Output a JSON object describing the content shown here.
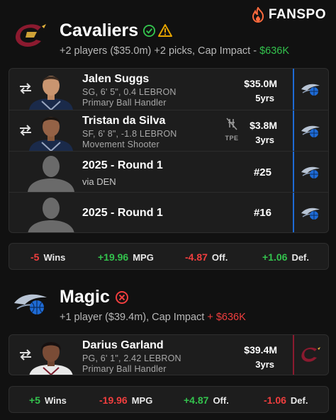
{
  "brand": {
    "name": "FANSPO",
    "logo_icon": "fanspo-flame-icon"
  },
  "colors": {
    "positive": "#33c24d",
    "negative": "#f03e3e",
    "magic_blue": "#1e6bd6",
    "cavs_wine": "#8b1a2f",
    "check": "#33c24d",
    "warn": "#e6a400"
  },
  "cavaliers": {
    "team_name": "Cavaliers",
    "status_icons": [
      "check-circle-icon",
      "warning-triangle-icon"
    ],
    "summary_main": "+2 players ($35.0m) +2 picks, Cap Impact - ",
    "summary_value": "$636K",
    "players": [
      {
        "name": "Jalen Suggs",
        "details": "SG, 6' 5\", 0.4 LEBRON",
        "role": "Primary Ball Handler",
        "salary": "$35.0M",
        "years": "5yrs",
        "from_logo": "magic-logo"
      },
      {
        "name": "Tristan da Silva",
        "details": "SF, 6' 8\", -1.8 LEBRON",
        "role": "Movement Shooter",
        "salary": "$3.8M",
        "years": "3yrs",
        "tpe_label": "TPE",
        "from_logo": "magic-logo"
      }
    ],
    "picks": [
      {
        "label": "2025 - Round 1",
        "via": "via DEN",
        "number": "#25",
        "from_logo": "magic-logo"
      },
      {
        "label": "2025 - Round 1",
        "number": "#16",
        "from_logo": "magic-logo"
      }
    ],
    "stats": {
      "wins": "-5",
      "wins_label": "Wins",
      "mpg": "+19.96",
      "mpg_label": "MPG",
      "off": "-4.87",
      "off_label": "Off.",
      "def": "+1.06",
      "def_label": "Def."
    }
  },
  "magic": {
    "team_name": "Magic",
    "status_icons": [
      "error-circle-icon"
    ],
    "summary_main": "+1 player ($39.4m), Cap Impact ",
    "summary_value": "+ $636K",
    "players": [
      {
        "name": "Darius Garland",
        "details": "PG, 6' 1\", 2.42 LEBRON",
        "role": "Primary Ball Handler",
        "salary": "$39.4M",
        "years": "3yrs",
        "from_logo": "cavaliers-logo"
      }
    ],
    "stats": {
      "wins": "+5",
      "wins_label": "Wins",
      "mpg": "-19.96",
      "mpg_label": "MPG",
      "off": "+4.87",
      "off_label": "Off.",
      "def": "-1.06",
      "def_label": "Def."
    }
  }
}
